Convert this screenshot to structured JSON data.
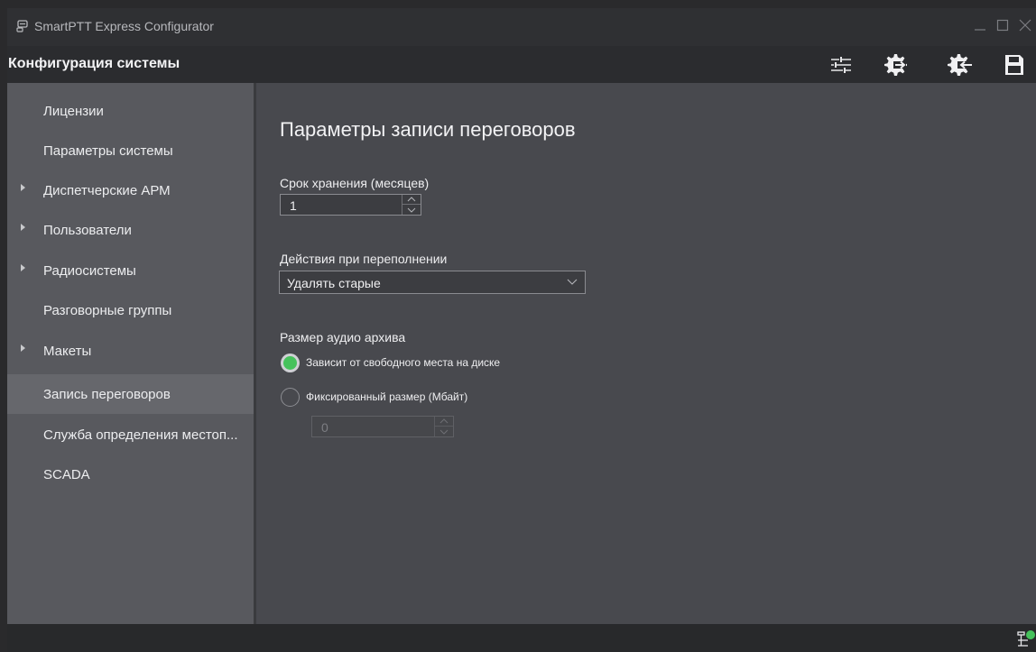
{
  "window": {
    "title": "SmartPTT Express Configurator",
    "controls": [
      "minimize",
      "maximize",
      "close"
    ]
  },
  "header": {
    "title": "Конфигурация системы",
    "tools": [
      "settings-sliders-icon",
      "export-config-icon",
      "import-config-icon",
      "save-icon"
    ]
  },
  "sidebar": {
    "items": [
      {
        "label": "Лицензии",
        "expandable": false,
        "selected": false
      },
      {
        "label": "Параметры системы",
        "expandable": false,
        "selected": false
      },
      {
        "label": "Диспетчерские АРМ",
        "expandable": true,
        "selected": false
      },
      {
        "label": "Пользователи",
        "expandable": true,
        "selected": false
      },
      {
        "label": "Радиосистемы",
        "expandable": true,
        "selected": false
      },
      {
        "label": "Разговорные группы",
        "expandable": false,
        "selected": false
      },
      {
        "label": "Макеты",
        "expandable": true,
        "selected": false
      },
      {
        "label": "Запись переговоров",
        "expandable": false,
        "selected": true
      },
      {
        "label": "Служба определения местоп...",
        "expandable": false,
        "selected": false
      },
      {
        "label": "SCADA",
        "expandable": false,
        "selected": false
      }
    ]
  },
  "main": {
    "title": "Параметры записи переговоров",
    "retention": {
      "label": "Срок хранения (месяцев)",
      "value": "1"
    },
    "overflow": {
      "label": "Действия при переполнении",
      "value": "Удалять старые"
    },
    "archive": {
      "label": "Размер аудио архива",
      "options": [
        {
          "label": "Зависит от свободного места на диске",
          "checked": true
        },
        {
          "label": "Фиксированный размер (Мбайт)",
          "checked": false
        }
      ],
      "fixed_size": {
        "value": "0",
        "enabled": false
      }
    }
  },
  "colors": {
    "accent": "#46c25c",
    "sidebar_bg": "#58595e",
    "content_bg": "#48494e",
    "header_bg": "#2b2c2f"
  }
}
